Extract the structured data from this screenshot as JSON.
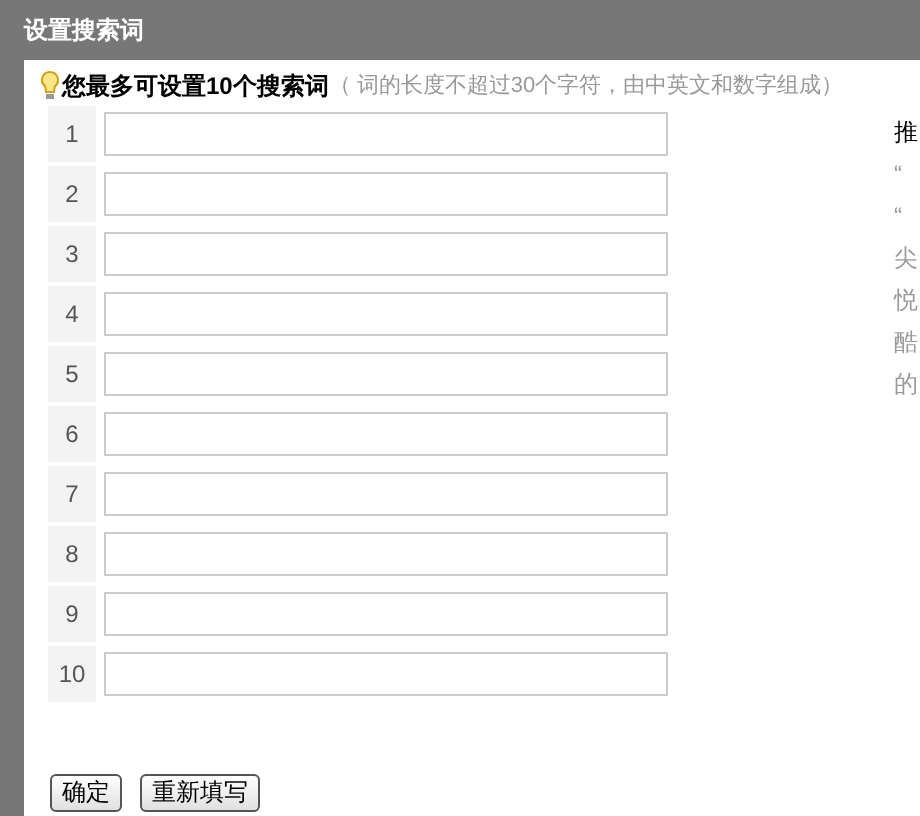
{
  "window": {
    "title": "设置搜索词"
  },
  "hint": {
    "main": "您最多可设置10个搜索词",
    "note": "（ 词的长度不超过30个字符，由中英文和数字组成）"
  },
  "rows": [
    {
      "number": "1"
    },
    {
      "number": "2"
    },
    {
      "number": "3"
    },
    {
      "number": "4"
    },
    {
      "number": "5"
    },
    {
      "number": "6"
    },
    {
      "number": "7"
    },
    {
      "number": "8"
    },
    {
      "number": "9"
    },
    {
      "number": "10"
    }
  ],
  "side_panel": {
    "heading": "推",
    "lines": [
      "“",
      "“",
      "尖",
      "悦",
      "酷",
      "的"
    ]
  },
  "buttons": [
    "确定",
    "重新填写"
  ]
}
